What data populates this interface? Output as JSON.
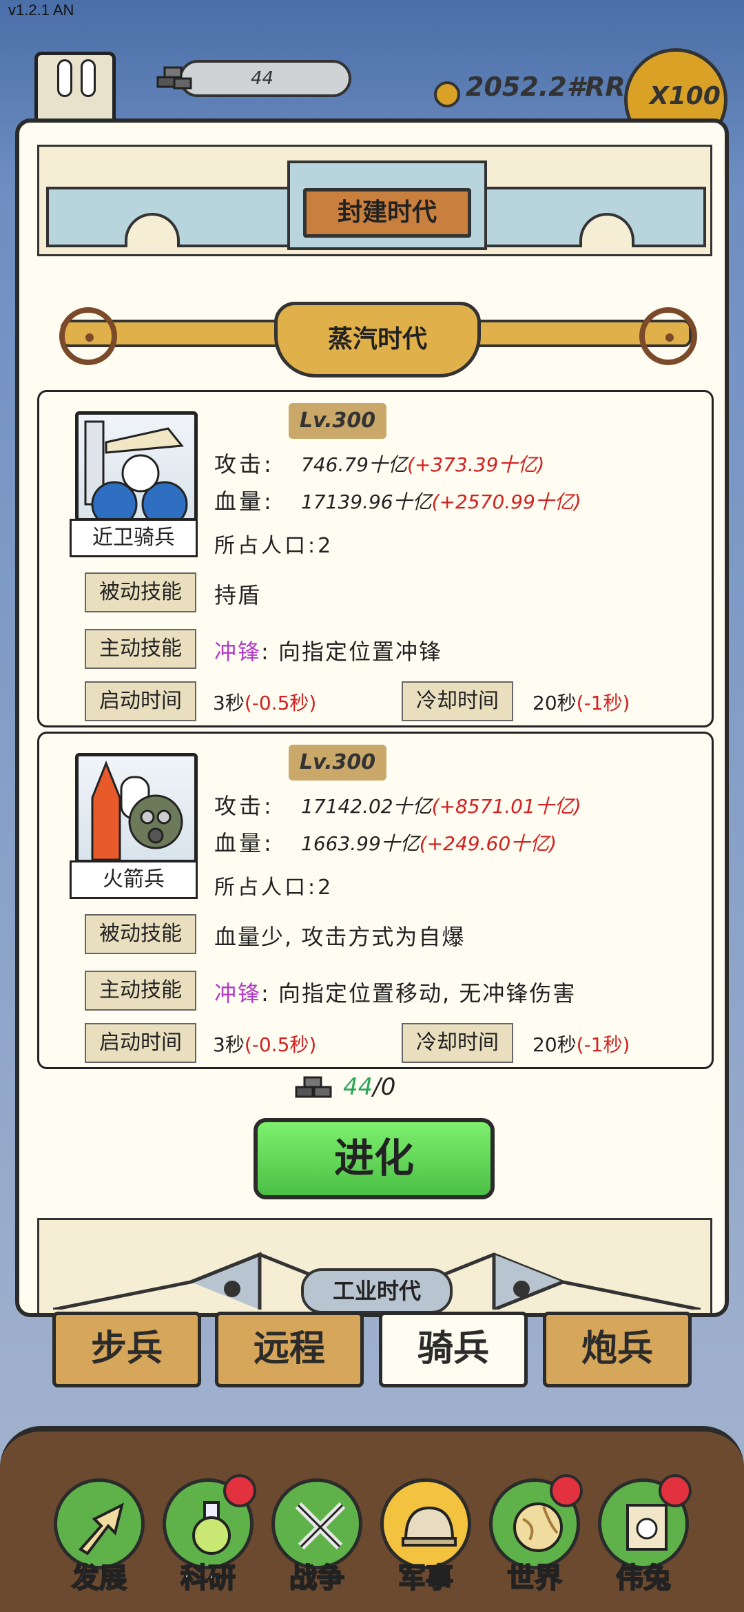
{
  "version": "v1.2.1 AN",
  "status": {
    "iron_count": "44",
    "coins": "2052.2#RR",
    "multiplier": "X100"
  },
  "eras": {
    "feudal": "封建时代",
    "steam": "蒸汽时代",
    "industrial": "工业时代"
  },
  "units": [
    {
      "name": "近卫骑兵",
      "level": "Lv.300",
      "attack_label": "攻击:",
      "attack_value": "746.79十亿",
      "attack_bonus": "(+373.39十亿)",
      "hp_label": "血量:",
      "hp_value": "17139.96十亿",
      "hp_bonus": "(+2570.99十亿)",
      "population": "所占人口:2",
      "passive_label": "被动技能",
      "passive_text": "持盾",
      "active_label": "主动技能",
      "active_keyword": "冲锋",
      "active_text": ": 向指定位置冲锋",
      "startup_label": "启动时间",
      "startup_value": "3秒",
      "startup_bonus": "(-0.5秒)",
      "cooldown_label": "冷却时间",
      "cooldown_value": "20秒",
      "cooldown_bonus": "(-1秒)"
    },
    {
      "name": "火箭兵",
      "level": "Lv.300",
      "attack_label": "攻击:",
      "attack_value": "17142.02十亿",
      "attack_bonus": "(+8571.01十亿)",
      "hp_label": "血量:",
      "hp_value": "1663.99十亿",
      "hp_bonus": "(+249.60十亿)",
      "population": "所占人口:2",
      "passive_label": "被动技能",
      "passive_text": "血量少, 攻击方式为自爆",
      "active_label": "主动技能",
      "active_keyword": "冲锋",
      "active_text": ": 向指定位置移动, 无冲锋伤害",
      "startup_label": "启动时间",
      "startup_value": "3秒",
      "startup_bonus": "(-0.5秒)",
      "cooldown_label": "冷却时间",
      "cooldown_value": "20秒",
      "cooldown_bonus": "(-1秒)"
    }
  ],
  "cost": {
    "have": "44",
    "need": "/0"
  },
  "evolve_label": "进化",
  "tabs": [
    "步兵",
    "远程",
    "骑兵",
    "炮兵"
  ],
  "active_tab": "骑兵",
  "nav": [
    {
      "label": "发展",
      "icon": "arrow-up-icon",
      "badge": false
    },
    {
      "label": "科研",
      "icon": "flask-icon",
      "badge": true
    },
    {
      "label": "战争",
      "icon": "crossed-swords-icon",
      "badge": false
    },
    {
      "label": "军事",
      "icon": "helmet-icon",
      "badge": false
    },
    {
      "label": "世界",
      "icon": "globe-icon",
      "badge": true
    },
    {
      "label": "伟兔",
      "icon": "portrait-icon",
      "badge": true
    }
  ],
  "active_nav": "军事",
  "colors": {
    "bonus_red": "#d32020",
    "keyword_purple": "#b13ac9",
    "have_green": "#2fa55a",
    "evolve_green": "#5fd24f",
    "badge_red": "#e3323f"
  }
}
